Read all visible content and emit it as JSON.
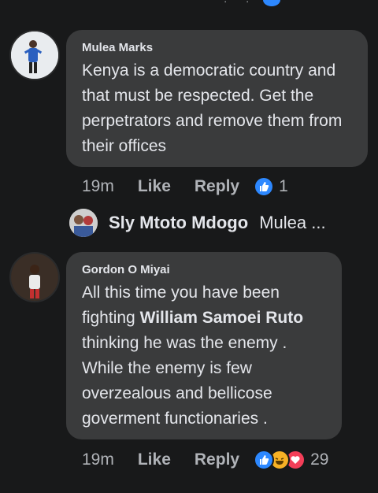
{
  "comments": [
    {
      "author": "Mulea Marks",
      "text": "Kenya is a democratic country and that must be respected. Get the perpetrators and remove them from their offices",
      "time": "19m",
      "like_label": "Like",
      "reply_label": "Reply",
      "reaction_count": "1",
      "reactions": [
        "like-icon"
      ]
    },
    {
      "author": "Gordon O Miyai",
      "text_before": "All this time you have been fighting ",
      "mention": "William Samoei Ruto",
      "text_after": " thinking he was the enemy . While the enemy is few overzealous and bellicose goverment functionaries .",
      "time": "19m",
      "like_label": "Like",
      "reply_label": "Reply",
      "reaction_count": "29",
      "reactions": [
        "like-icon",
        "haha-icon",
        "love-icon"
      ]
    }
  ],
  "reply_preview": {
    "author": "Sly Mtoto Mdogo",
    "snippet": "Mulea ..."
  },
  "colors": {
    "background": "#18191a",
    "bubble": "#3a3b3c",
    "text": "#e4e6eb",
    "secondary": "#b0b3b8",
    "like_blue": "#2d88ff",
    "love_red": "#f33e58",
    "haha_yellow": "#f7b125"
  }
}
